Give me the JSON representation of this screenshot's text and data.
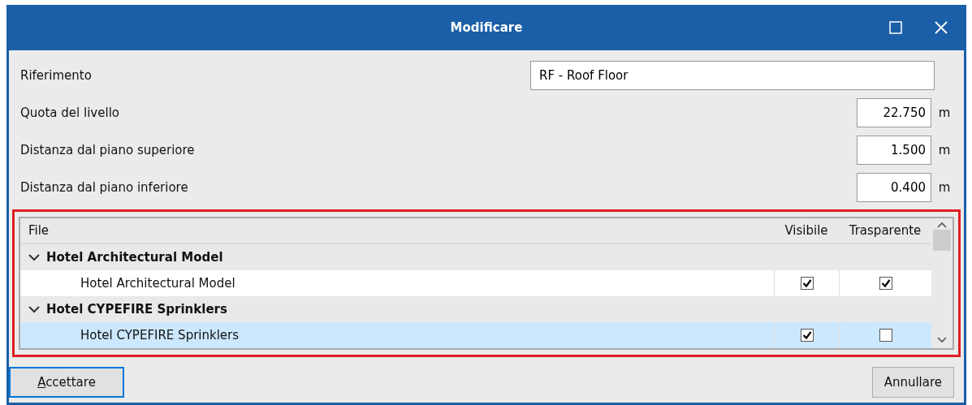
{
  "window": {
    "title": "Modificare"
  },
  "fields": [
    {
      "label": "Riferimento",
      "value": "RF - Roof Floor",
      "kind": "text"
    },
    {
      "label": "Quota del livello",
      "value": "22.750",
      "unit": "m",
      "kind": "number"
    },
    {
      "label": "Distanza dal piano superiore",
      "value": "1.500",
      "unit": "m",
      "kind": "number"
    },
    {
      "label": "Distanza dal piano inferiore",
      "value": "0.400",
      "unit": "m",
      "kind": "number"
    }
  ],
  "table": {
    "columns": [
      "File",
      "Visibile",
      "Trasparente"
    ],
    "groups": [
      {
        "name": "Hotel Architectural Model",
        "expanded": true,
        "children": [
          {
            "name": "Hotel Architectural Model",
            "visible": true,
            "transparent": true,
            "selected": false
          }
        ]
      },
      {
        "name": "Hotel CYPEFIRE Sprinklers",
        "expanded": true,
        "children": [
          {
            "name": "Hotel CYPEFIRE Sprinklers",
            "visible": true,
            "transparent": false,
            "selected": true
          }
        ]
      }
    ]
  },
  "buttons": [
    {
      "label": "Accettare",
      "default": true,
      "mnemonic": true
    },
    {
      "label": "Annullare",
      "default": false,
      "mnemonic": false
    }
  ]
}
